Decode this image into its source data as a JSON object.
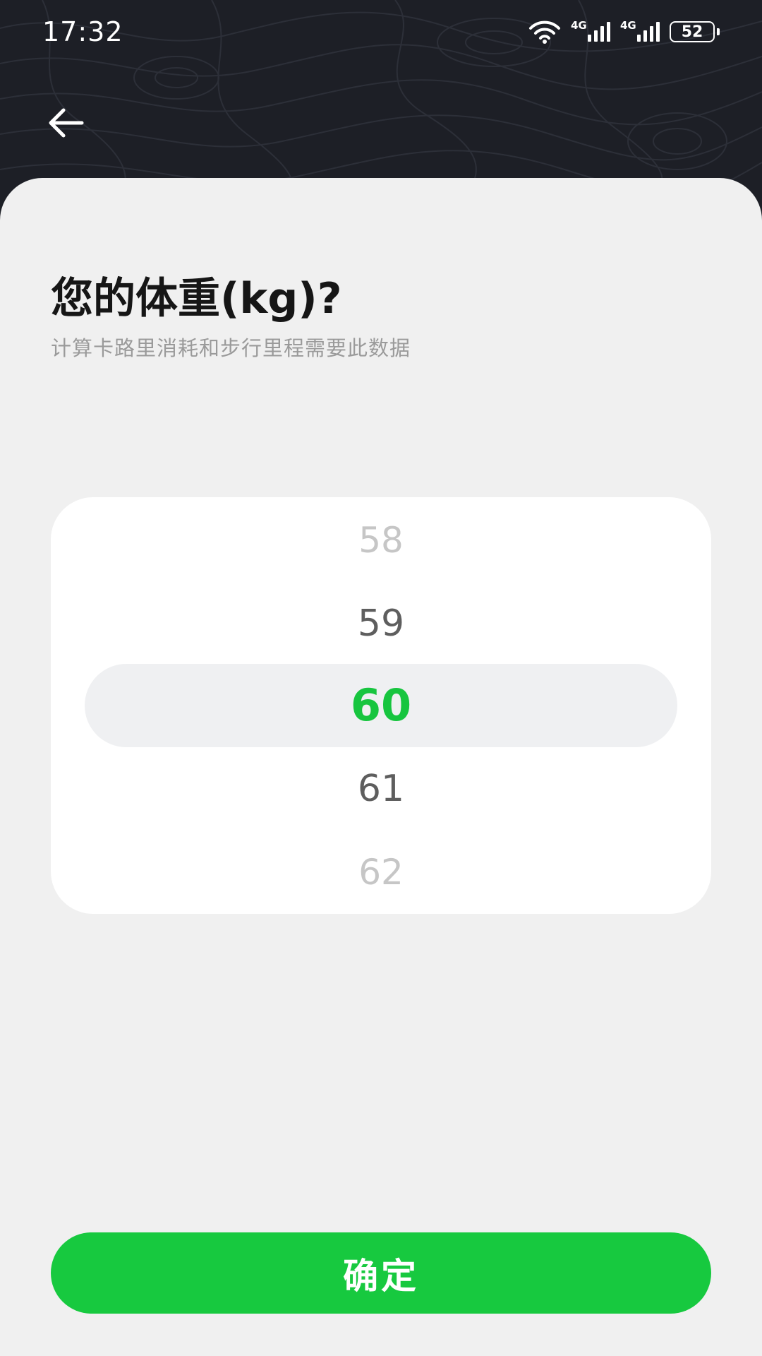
{
  "status_bar": {
    "time": "17:32",
    "network_1": "4G",
    "network_2": "4G",
    "battery": "52"
  },
  "header": {
    "back_icon": "arrow-left-icon"
  },
  "page": {
    "title": "您的体重(kg)?",
    "subtitle": "计算卡路里消耗和步行里程需要此数据"
  },
  "picker": {
    "items": [
      "58",
      "59",
      "60",
      "61",
      "62"
    ],
    "selected_value": "60",
    "selected_color": "#17c53f"
  },
  "confirm": {
    "label": "确定",
    "color": "#17c93f"
  }
}
